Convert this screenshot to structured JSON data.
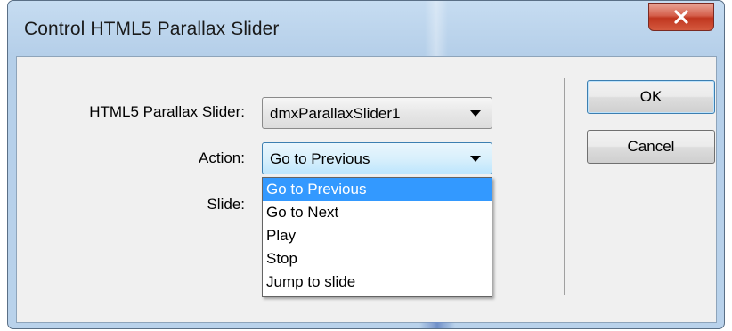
{
  "window": {
    "title": "Control HTML5 Parallax Slider",
    "close_label": "x"
  },
  "form": {
    "slider_label": "HTML5 Parallax Slider:",
    "slider_value": "dmxParallaxSlider1",
    "action_label": "Action:",
    "action_value": "Go to Previous",
    "slide_label": "Slide:"
  },
  "action_options": [
    {
      "label": "Go to Previous",
      "selected": true
    },
    {
      "label": "Go to Next",
      "selected": false
    },
    {
      "label": "Play",
      "selected": false
    },
    {
      "label": "Stop",
      "selected": false
    },
    {
      "label": "Jump to slide",
      "selected": false
    }
  ],
  "buttons": {
    "ok_label": "OK",
    "cancel_label": "Cancel"
  },
  "colors": {
    "selection": "#3399ff",
    "close_button": "#c0361f",
    "frame": "#b5cfe9"
  }
}
